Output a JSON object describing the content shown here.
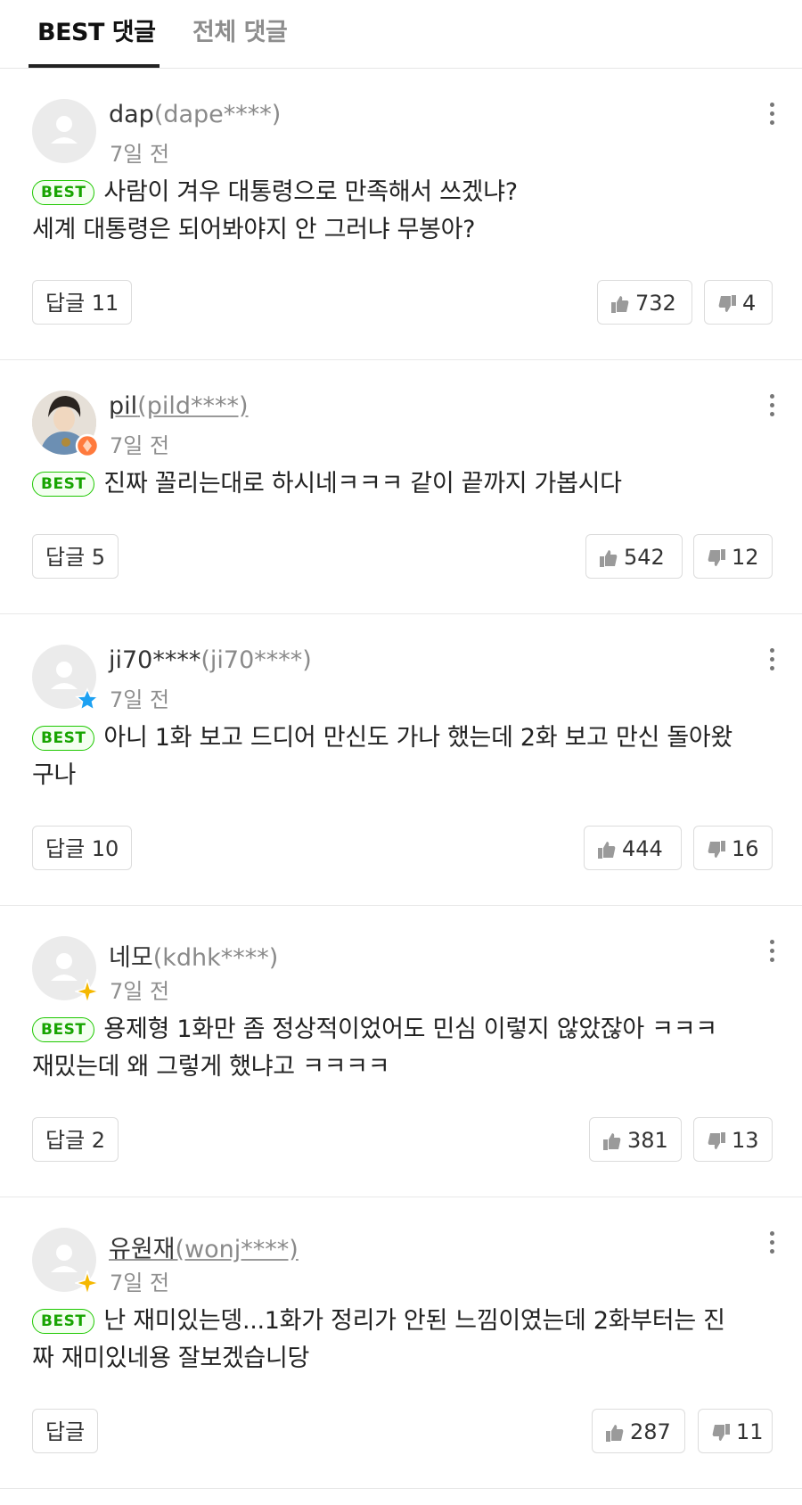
{
  "tabs": {
    "best": "BEST 댓글",
    "all": "전체 댓글"
  },
  "best_badge": "BEST",
  "comments": [
    {
      "nick": "dap",
      "uid": "(dape****)",
      "time": "7일 전",
      "line1": "사람이 겨우 대통령으로 만족해서 쓰겠냐?",
      "line2": "세계 대통령은 되어봐야지 안 그러냐 무봉아?",
      "reply": "답글 11",
      "likes": "732",
      "dislikes": "4"
    },
    {
      "nick": "pil",
      "uid": "(pild****)",
      "time": "7일 전",
      "line1": "진짜 꼴리는대로 하시네ㅋㅋㅋ 같이 끝까지 가봅시다",
      "line2": "",
      "reply": "답글 5",
      "likes": "542",
      "dislikes": "12"
    },
    {
      "nick": "ji70****",
      "uid": "(ji70****)",
      "time": "7일 전",
      "line1": "아니 1화 보고 드디어 만신도 가나 했는데 2화 보고 만신 돌아왔",
      "line2": "구나",
      "reply": "답글 10",
      "likes": "444",
      "dislikes": "16"
    },
    {
      "nick": "네모",
      "uid": "(kdhk****)",
      "time": "7일 전",
      "line1": "용제형 1화만 좀 정상적이었어도 민심 이렇지 않았잖아 ㅋㅋㅋ",
      "line2": "재밌는데 왜 그렇게 했냐고 ㅋㅋㅋㅋ",
      "reply": "답글 2",
      "likes": "381",
      "dislikes": "13"
    },
    {
      "nick": "유원재",
      "uid": "(wonj****)",
      "time": "7일 전",
      "line1": "난 재미있는뎅...1화가 정리가 안된 느낌이였는데 2화부터는 진",
      "line2": "짜 재미있네용 잘보겠습니당",
      "reply": "답글",
      "likes": "287",
      "dislikes": "11"
    }
  ],
  "colors": {
    "best_green": "#1ec800",
    "star_blue": "#1da1f2",
    "star_gold": "#f5b800",
    "badge_orange": "#ff7a3d"
  },
  "icons": {
    "more": "more-vertical-icon",
    "like": "thumb-up-icon",
    "dislike": "thumb-down-icon",
    "avatar": "default-avatar-icon"
  }
}
